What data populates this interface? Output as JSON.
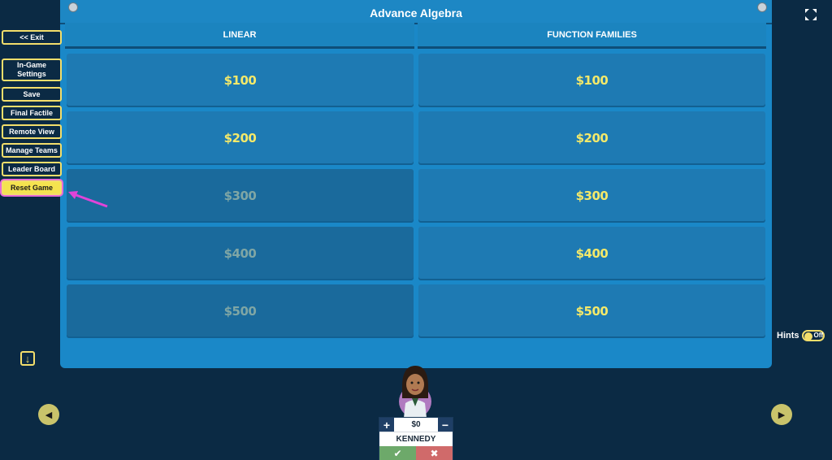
{
  "board": {
    "title": "Advance Algebra",
    "categories": [
      "LINEAR",
      "FUNCTION FAMILIES"
    ],
    "columns": [
      [
        "$100",
        "$200",
        "$300",
        "$400",
        "$500"
      ],
      [
        "$100",
        "$200",
        "$300",
        "$400",
        "$500"
      ]
    ]
  },
  "sidebar": {
    "items": [
      {
        "label": "<< Exit"
      },
      {
        "label": "In-Game Settings"
      },
      {
        "label": "Save"
      },
      {
        "label": "Final Factile"
      },
      {
        "label": "Remote View"
      },
      {
        "label": "Manage Teams"
      },
      {
        "label": "Leader Board"
      },
      {
        "label": "Reset Game"
      }
    ]
  },
  "hints": {
    "label": "Hints",
    "state": "Off"
  },
  "team": {
    "score": "$0",
    "name": "KENNEDY"
  },
  "icons": {
    "fullscreen": "fullscreen-icon",
    "down": "arrow-down-icon",
    "prev": "chevron-left-icon",
    "next": "chevron-right-icon"
  },
  "colors": {
    "accent": "#f3de6b",
    "board": "#1b8cc9",
    "highlight": "#e86bd6"
  }
}
